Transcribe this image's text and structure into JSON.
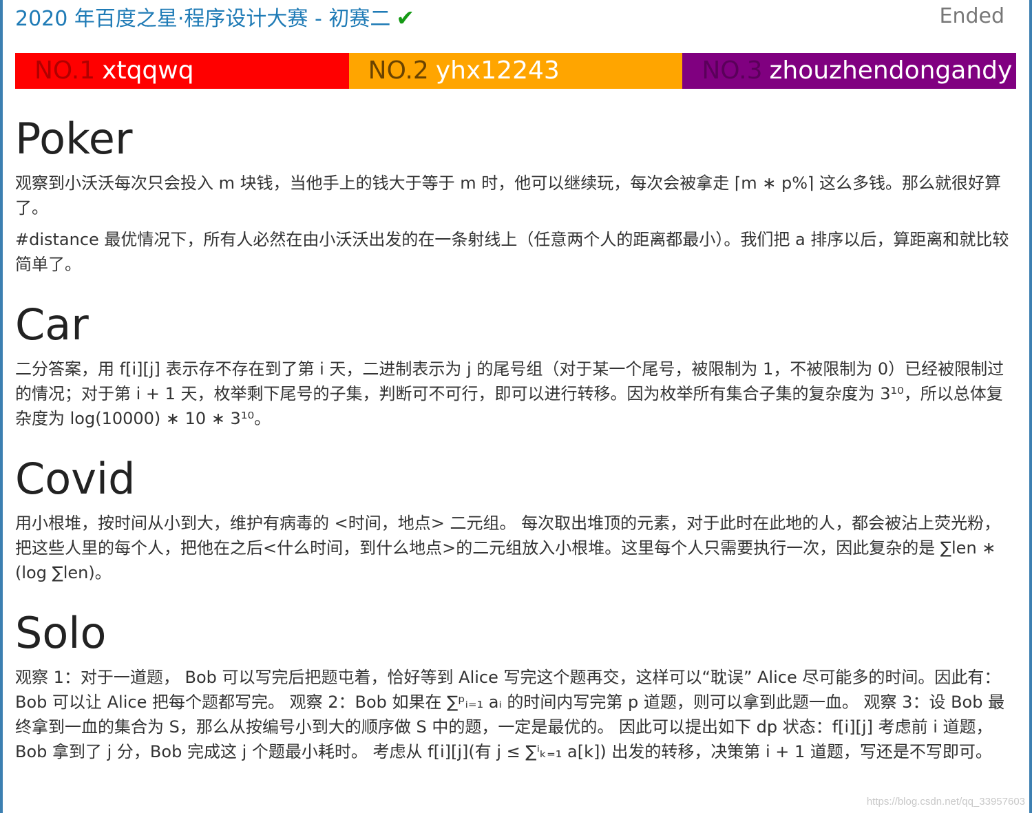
{
  "header": {
    "title": "2020 年百度之星·程序设计大赛 - 初赛二",
    "check_icon": "✔",
    "status": "Ended"
  },
  "rankings": [
    {
      "no": "NO.1",
      "name": "xtqqwq",
      "color": "#ff0000"
    },
    {
      "no": "NO.2",
      "name": "yhx12243",
      "color": "#ffa500"
    },
    {
      "no": "NO.3",
      "name": "zhouzhendongandy",
      "color": "#800080"
    }
  ],
  "sections": {
    "poker": {
      "title": "Poker",
      "p1": "观察到小沃沃每次只会投入 m 块钱，当他手上的钱大于等于 m 时，他可以继续玩，每次会被拿走 ⌈m ∗ p%⌉ 这么多钱。那么就很好算了。",
      "p2": "#distance 最优情况下，所有人必然在由小沃沃出发的在一条射线上（任意两个人的距离都最小）。我们把 a 排序以后，算距离和就比较简单了。"
    },
    "car": {
      "title": "Car",
      "p1": "二分答案，用 f[i][j] 表示存不存在到了第 i 天，二进制表示为 j 的尾号组（对于某一个尾号，被限制为 1，不被限制为 0）已经被限制过的情况；对于第 i + 1 天，枚举剩下尾号的子集，判断可不可行，即可以进行转移。因为枚举所有集合子集的复杂度为 3¹⁰，所以总体复杂度为 log(10000) ∗ 10 ∗ 3¹⁰。"
    },
    "covid": {
      "title": "Covid",
      "p1": "用小根堆，按时间从小到大，维护有病毒的 <时间，地点> 二元组。 每次取出堆顶的元素，对于此时在此地的人，都会被沾上荧光粉，把这些人里的每个人，把他在之后<什么时间，到什么地点>的二元组放入小根堆。这里每个人只需要执行一次，因此复杂的是 ∑len ∗ (log ∑len)。"
    },
    "solo": {
      "title": "Solo",
      "p1": "观察 1：对于一道题， Bob 可以写完后把题屯着，恰好等到 Alice 写完这个题再交，这样可以“耽误” Alice 尽可能多的时间。因此有：Bob 可以让 Alice 把每个题都写完。 观察 2：Bob 如果在 ∑ᵖᵢ₌₁ aᵢ 的时间内写完第 p 道题，则可以拿到此题一血。 观察 3：设 Bob 最终拿到一血的集合为 S，那么从按编号小到大的顺序做 S 中的题，一定是最优的。 因此可以提出如下 dp 状态：f[i][j] 考虑前 i 道题，Bob 拿到了 j 分，Bob 完成这 j 个题最小耗时。 考虑从 f[i][j](有 j ≤ ∑ⁱₖ₌₁ a[k]) 出发的转移，决策第 i + 1 道题，写还是不写即可。"
    }
  },
  "watermark": "https://blog.csdn.net/qq_33957603"
}
